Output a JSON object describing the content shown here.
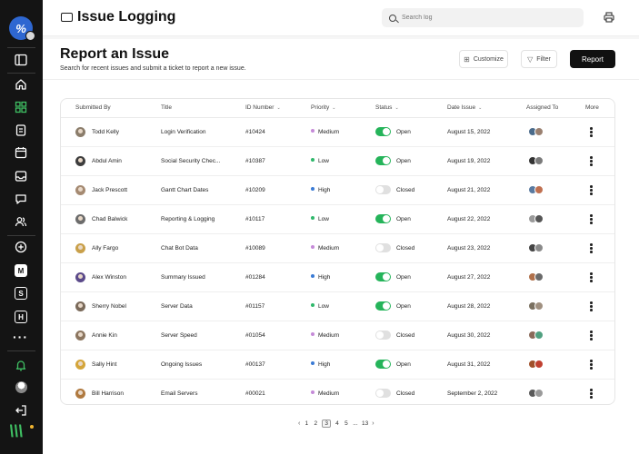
{
  "app": {
    "title": "Issue Logging"
  },
  "search": {
    "placeholder": "Search log"
  },
  "header": {
    "title": "Report an Issue",
    "subtitle": "Search for recent issues and submit a ticket to report a new issue.",
    "customize_label": "Customize",
    "filter_label": "Filter",
    "report_label": "Report"
  },
  "sidebar": {
    "letters": [
      "M",
      "S",
      "H"
    ]
  },
  "table": {
    "columns": [
      "Submitted By",
      "Title",
      "ID Number",
      "Priority",
      "Status",
      "Date Issue",
      "Assigned To",
      "More"
    ],
    "rows": [
      {
        "name": "Todd Kelly",
        "title": "Login Verification",
        "id": "#10424",
        "priority": "Medium",
        "status": "Open",
        "date": "August 15, 2022"
      },
      {
        "name": "Abdul Amin",
        "title": "Social Security Chec...",
        "id": "#10387",
        "priority": "Low",
        "status": "Open",
        "date": "August 19, 2022"
      },
      {
        "name": "Jack Prescott",
        "title": "Gantt Chart Dates",
        "id": "#10209",
        "priority": "High",
        "status": "Closed",
        "date": "August 21, 2022"
      },
      {
        "name": "Chad Balwick",
        "title": "Reporting & Logging",
        "id": "#10117",
        "priority": "Low",
        "status": "Open",
        "date": "August 22, 2022"
      },
      {
        "name": "Ally Fargo",
        "title": "Chat Bot Data",
        "id": "#10089",
        "priority": "Medium",
        "status": "Closed",
        "date": "August 23, 2022"
      },
      {
        "name": "Alex Winston",
        "title": "Summary Issued",
        "id": "#01284",
        "priority": "High",
        "status": "Open",
        "date": "August 27, 2022"
      },
      {
        "name": "Sherry Nobel",
        "title": "Server Data",
        "id": "#01157",
        "priority": "Low",
        "status": "Open",
        "date": "August 28, 2022"
      },
      {
        "name": "Annie Kin",
        "title": "Server Speed",
        "id": "#01054",
        "priority": "Medium",
        "status": "Closed",
        "date": "August 30, 2022"
      },
      {
        "name": "Sally Hint",
        "title": "Ongoing Issues",
        "id": "#00137",
        "priority": "High",
        "status": "Open",
        "date": "August 31, 2022"
      },
      {
        "name": "Bill Harrison",
        "title": "Email Servers",
        "id": "#00021",
        "priority": "Medium",
        "status": "Closed",
        "date": "September 2, 2022"
      }
    ]
  },
  "priority_colors": {
    "Medium": "#c58ad8",
    "Low": "#2fb86b",
    "High": "#3a7bd5"
  },
  "pagination": {
    "pages": [
      "1",
      "2",
      "3",
      "4",
      "5",
      "...",
      "13"
    ],
    "current": "3",
    "prev": "‹",
    "next": "›"
  }
}
